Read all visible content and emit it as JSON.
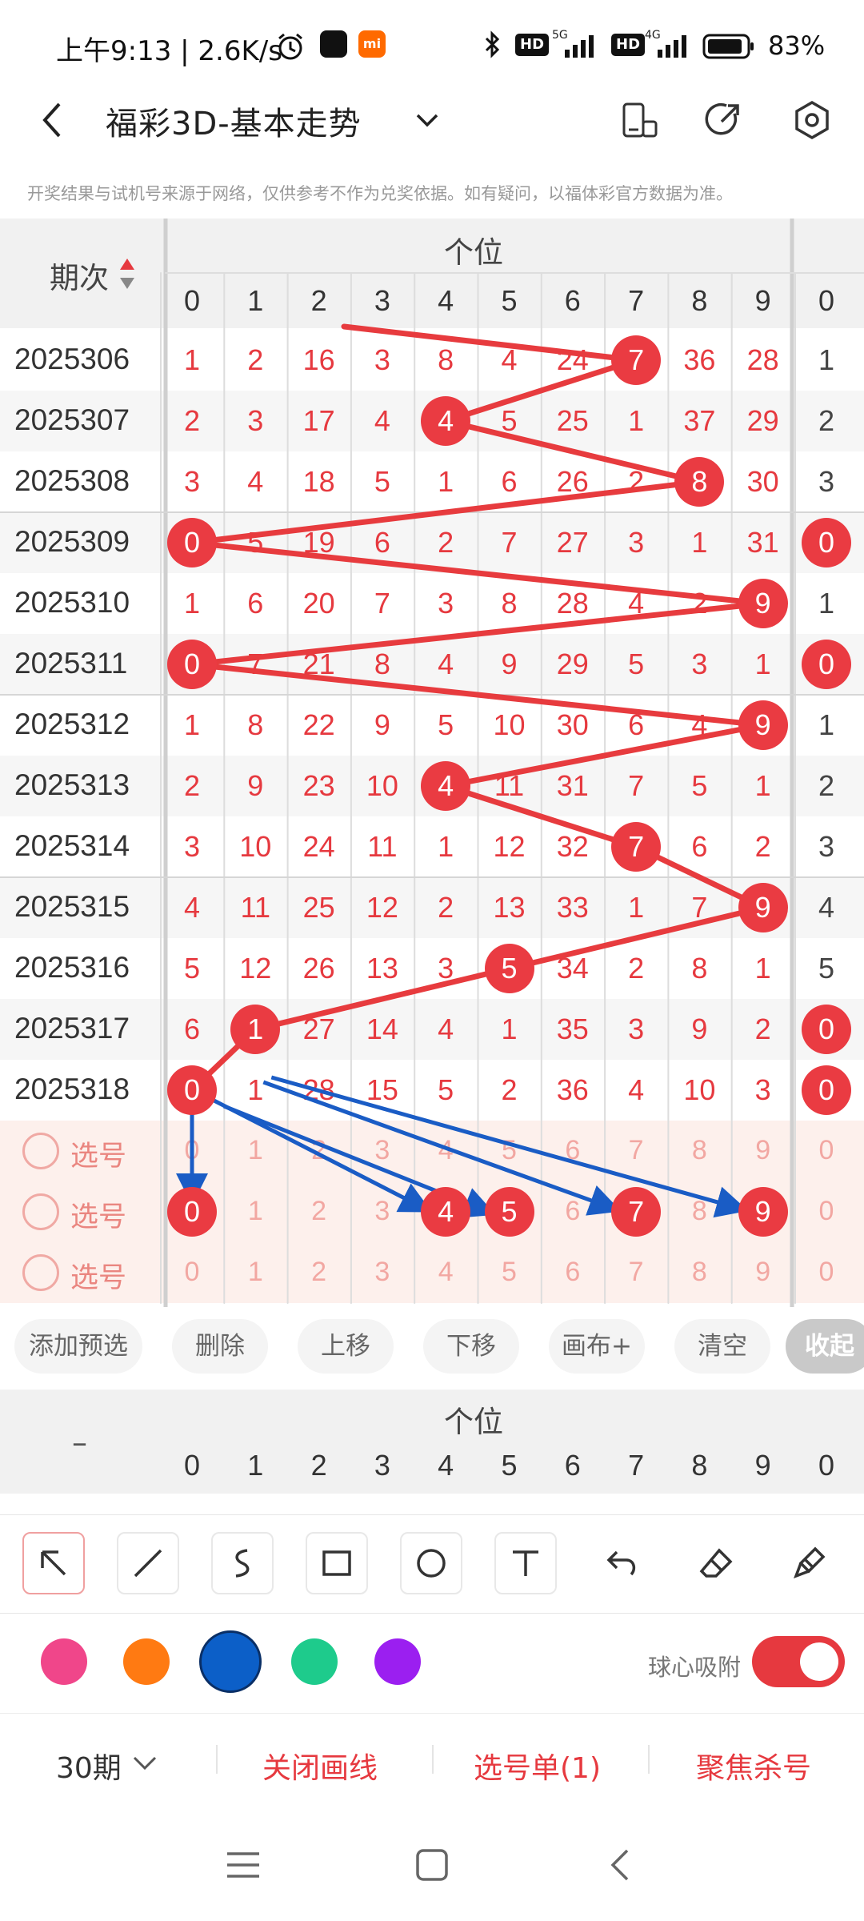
{
  "status_bar": {
    "time": "上午9:13 | 2.6K/s",
    "battery": "83%",
    "badge_hd1": "HD",
    "badge_hd2": "HD",
    "net1": "5G",
    "net2": "4G"
  },
  "header": {
    "title": "福彩3D-基本走势",
    "disclaimer": "开奖结果与试机号来源于网络，仅供参考不作为兑奖依据。如有疑问，以福体彩官方数据为准。"
  },
  "table": {
    "period_header": "期次",
    "group_label": "个位",
    "columns": [
      "0",
      "1",
      "2",
      "3",
      "4",
      "5",
      "6",
      "7",
      "8",
      "9"
    ],
    "extra_column": "0",
    "rows": [
      {
        "period": "2025306",
        "cells": [
          "1",
          "2",
          "16",
          "3",
          "8",
          "4",
          "24",
          "7",
          "36",
          "28"
        ],
        "extra": "1",
        "hit": 7
      },
      {
        "period": "2025307",
        "cells": [
          "2",
          "3",
          "17",
          "4",
          "4",
          "5",
          "25",
          "1",
          "37",
          "29"
        ],
        "extra": "2",
        "hit": 4
      },
      {
        "period": "2025308",
        "cells": [
          "3",
          "4",
          "18",
          "5",
          "1",
          "6",
          "26",
          "2",
          "8",
          "30"
        ],
        "extra": "3",
        "hit": 8
      },
      {
        "period": "2025309",
        "cells": [
          "0",
          "5",
          "19",
          "6",
          "2",
          "7",
          "27",
          "3",
          "1",
          "31"
        ],
        "extra": "0",
        "hit": 0
      },
      {
        "period": "2025310",
        "cells": [
          "1",
          "6",
          "20",
          "7",
          "3",
          "8",
          "28",
          "4",
          "2",
          "9"
        ],
        "extra": "1",
        "hit": 9
      },
      {
        "period": "2025311",
        "cells": [
          "0",
          "7",
          "21",
          "8",
          "4",
          "9",
          "29",
          "5",
          "3",
          "1"
        ],
        "extra": "0",
        "hit": 0
      },
      {
        "period": "2025312",
        "cells": [
          "1",
          "8",
          "22",
          "9",
          "5",
          "10",
          "30",
          "6",
          "4",
          "9"
        ],
        "extra": "1",
        "hit": 9
      },
      {
        "period": "2025313",
        "cells": [
          "2",
          "9",
          "23",
          "10",
          "4",
          "11",
          "31",
          "7",
          "5",
          "1"
        ],
        "extra": "2",
        "hit": 4
      },
      {
        "period": "2025314",
        "cells": [
          "3",
          "10",
          "24",
          "11",
          "1",
          "12",
          "32",
          "7",
          "6",
          "2"
        ],
        "extra": "3",
        "hit": 7
      },
      {
        "period": "2025315",
        "cells": [
          "4",
          "11",
          "25",
          "12",
          "2",
          "13",
          "33",
          "1",
          "7",
          "9"
        ],
        "extra": "4",
        "hit": 9
      },
      {
        "period": "2025316",
        "cells": [
          "5",
          "12",
          "26",
          "13",
          "3",
          "5",
          "34",
          "2",
          "8",
          "1"
        ],
        "extra": "5",
        "hit": 5
      },
      {
        "period": "2025317",
        "cells": [
          "6",
          "1",
          "27",
          "14",
          "4",
          "1",
          "35",
          "3",
          "9",
          "2"
        ],
        "extra": "0",
        "hit": 1
      },
      {
        "period": "2025318",
        "cells": [
          "0",
          "1",
          "28",
          "15",
          "5",
          "2",
          "36",
          "4",
          "10",
          "3"
        ],
        "extra": "0",
        "hit": 0
      }
    ],
    "select_label": "选号",
    "select_rows": [
      {
        "cells": [
          "0",
          "1",
          "2",
          "3",
          "4",
          "5",
          "6",
          "7",
          "8",
          "9"
        ],
        "extra": "0",
        "balls": []
      },
      {
        "cells": [
          "0",
          "1",
          "2",
          "3",
          "4",
          "5",
          "6",
          "7",
          "8",
          "9"
        ],
        "extra": "0",
        "balls": [
          0,
          4,
          5,
          7,
          9
        ]
      },
      {
        "cells": [
          "0",
          "1",
          "2",
          "3",
          "4",
          "5",
          "6",
          "7",
          "8",
          "9"
        ],
        "extra": "0",
        "balls": []
      }
    ]
  },
  "actions": {
    "add": "添加预选",
    "delete": "删除",
    "up": "上移",
    "down": "下移",
    "canvas": "画布+",
    "clear": "清空",
    "collapse": "收起"
  },
  "mini_table": {
    "dash": "–",
    "group_label": "个位",
    "columns": [
      "0",
      "1",
      "2",
      "3",
      "4",
      "5",
      "6",
      "7",
      "8",
      "9"
    ],
    "extra": "0"
  },
  "drawing": {
    "palette": [
      "#f0468a",
      "#ff7a12",
      "#0c5fc8",
      "#1ecb8c",
      "#9b1ff0"
    ],
    "selected_color": "#0c5fc8",
    "snap_label": "球心吸附",
    "snap_on": true
  },
  "bottom_bar": {
    "period_select": "30期",
    "close_lines": "关闭画线",
    "selection_list": "选号单(1)",
    "focus_kill": "聚焦杀号"
  },
  "colors": {
    "accent": "#e6393f",
    "line_red": "#e73b3e",
    "line_blue": "#1a5cc5"
  }
}
